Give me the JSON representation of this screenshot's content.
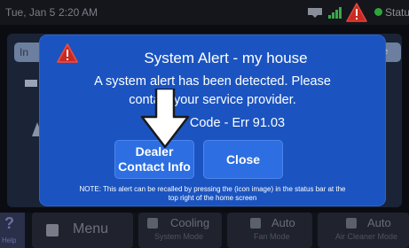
{
  "status_bar": {
    "date": "Tue, Jan 5",
    "time": "2:20 AM",
    "status_label": "Status"
  },
  "background": {
    "tab_left": "In",
    "tab_right": "ture"
  },
  "alert": {
    "title": "System Alert - my house",
    "message_line1": "A system alert has been detected. Please",
    "message_line2": "contact your service provider.",
    "code": "Code - Err 91.03",
    "dealer_button_line1": "Dealer",
    "dealer_button_line2": "Contact Info",
    "close_button": "Close",
    "note_line1": "NOTE: This alert can be recalled by pressing the (icon image) in the status bar at the",
    "note_line2": "top right of the home screen"
  },
  "bottom_nav": {
    "help": "Help",
    "menu": "Menu",
    "cooling_main": "Cooling",
    "cooling_sub": "System Mode",
    "fan_main": "Auto",
    "fan_sub": "Fan Mode",
    "air_main": "Auto",
    "air_sub": "Air Cleaner Mode"
  },
  "colors": {
    "modal_bg": "#1b54c0",
    "button_bg": "#2d6fe2",
    "alert_red": "#e0322a",
    "status_green": "#2ea43a"
  }
}
